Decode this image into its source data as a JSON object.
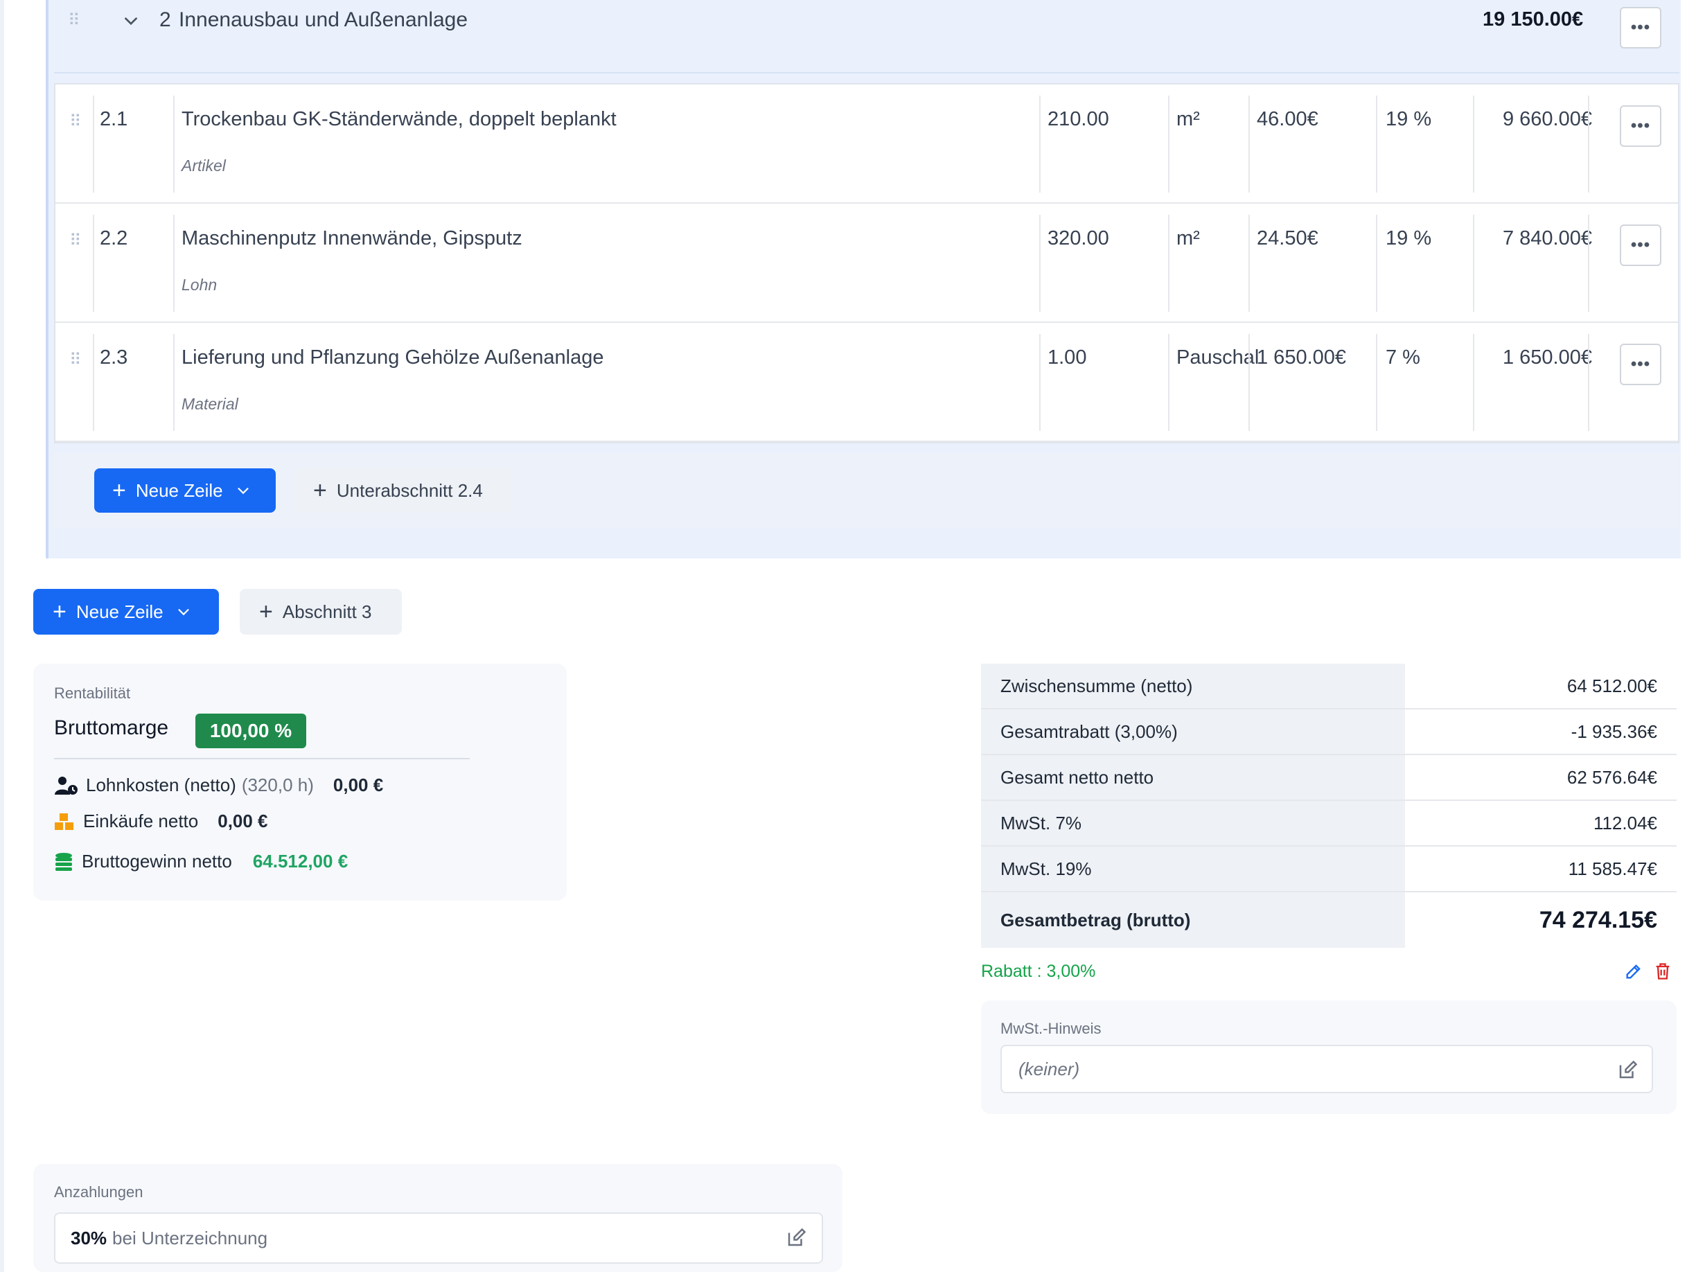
{
  "section": {
    "number": "2",
    "title": "Innenausbau und Außenanlage",
    "total": "19 150.00€",
    "rows": [
      {
        "pos": "2.1",
        "name": "Trockenbau GK-Ständerwände, doppelt beplankt",
        "type": "Artikel",
        "qty": "210.00",
        "unit": "m²",
        "price": "46.00€",
        "vat": "19 %",
        "total": "9 660.00€"
      },
      {
        "pos": "2.2",
        "name": "Maschinenputz Innenwände, Gipsputz",
        "type": "Lohn",
        "qty": "320.00",
        "unit": "m²",
        "price": "24.50€",
        "vat": "19 %",
        "total": "7 840.00€"
      },
      {
        "pos": "2.3",
        "name": "Lieferung und Pflanzung Gehölze Außenanlage",
        "type": "Material",
        "qty": "1.00",
        "unit": "Pauschal",
        "price": "1 650.00€",
        "vat": "7 %",
        "total": "1 650.00€"
      }
    ],
    "new_line_label": "Neue Zeile",
    "subsection_label": "Unterabschnitt 2.4"
  },
  "bottom_actions": {
    "new_line_label": "Neue Zeile",
    "section_label": "Abschnitt 3"
  },
  "profitability": {
    "title": "Rentabilität",
    "margin_label": "Bruttomarge",
    "margin_value": "100,00 %",
    "labor_label": "Lohnkosten (netto)",
    "labor_hours": "(320,0 h)",
    "labor_value": "0,00 €",
    "purchases_label": "Einkäufe netto",
    "purchases_value": "0,00 €",
    "profit_label": "Bruttogewinn netto",
    "profit_value": "64.512,00 €"
  },
  "totals": {
    "subtotal_label": "Zwischensumme (netto)",
    "subtotal_value": "64 512.00€",
    "discount_label": "Gesamtrabatt (3,00%)",
    "discount_value": "-1 935.36€",
    "net_label": "Gesamt netto netto",
    "net_value": "62 576.64€",
    "vat7_label": "MwSt. 7%",
    "vat7_value": "112.04€",
    "vat19_label": "MwSt. 19%",
    "vat19_value": "11 585.47€",
    "gross_label": "Gesamtbetrag (brutto)",
    "gross_value": "74 274.15€",
    "rabatt_text": "Rabatt : 3,00%"
  },
  "vat_note": {
    "title": "MwSt.-Hinweis",
    "value": "(keiner)"
  },
  "deposits": {
    "title": "Anzahlungen",
    "percent": "30%",
    "text": "bei Unterzeichnung"
  },
  "colors": {
    "primary": "#1769f4",
    "success": "#1f8a4c",
    "danger": "#dc2626"
  }
}
